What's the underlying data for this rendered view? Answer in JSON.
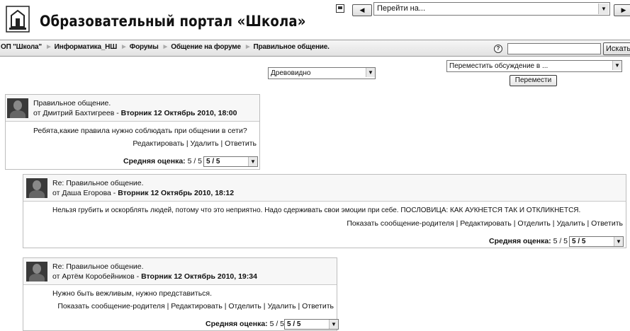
{
  "header": {
    "site_title": "Образовательный портал «Школа»",
    "jump_select": "Перейти на...",
    "prev_label": "◀",
    "next_label": "▶"
  },
  "navbar": {
    "crumbs": [
      "ОП \"Школа\"",
      "Информатика_НШ",
      "Форумы",
      "Общение на форуме",
      "Правильное общение."
    ],
    "separator": "►",
    "search_button": "Искать",
    "help_label": "?"
  },
  "controls": {
    "display_mode": "Древовидно",
    "move_select": "Переместить обсуждение в ...",
    "move_button": "Перемести"
  },
  "posts": [
    {
      "subject": "Правильное общение.",
      "author_prefix": "от Дмитрий Бахтигреев - ",
      "date": "Вторник 12 Октябрь 2010, 18:00",
      "body": "Ребята,какие правила нужно соблюдать при общении в сети?",
      "links": "Редактировать | Удалить | Ответить",
      "rating_label": "Средняя оценка:",
      "rating_value": "5 / 5",
      "rating_select": "5 / 5"
    },
    {
      "subject": "Re: Правильное общение.",
      "author_prefix": "от Даша Егорова - ",
      "date": "Вторник 12 Октябрь 2010, 18:12",
      "body": "Нельзя грубить и оскорблять людей, потому что это неприятно. Надо сдерживать свои эмоции при себе. ПОСЛОВИЦА: КАК АУКНЕТСЯ ТАК И ОТКЛИКНЕТСЯ.",
      "links": "Показать сообщение-родителя | Редактировать | Отделить | Удалить | Ответить",
      "rating_label": "Средняя оценка:",
      "rating_value": "5 / 5",
      "rating_select": "5 / 5"
    },
    {
      "subject": "Re: Правильное общение.",
      "author_prefix": "от Артём Коробейников - ",
      "date": "Вторник 12 Октябрь 2010, 19:34",
      "body": "Нужно быть вежливым, нужно представиться.",
      "links": "Показать сообщение-родителя | Редактировать | Отделить | Удалить | Ответить",
      "rating_label": "Средняя оценка:",
      "rating_value": "5 / 5",
      "rating_select": "5 / 5"
    }
  ]
}
